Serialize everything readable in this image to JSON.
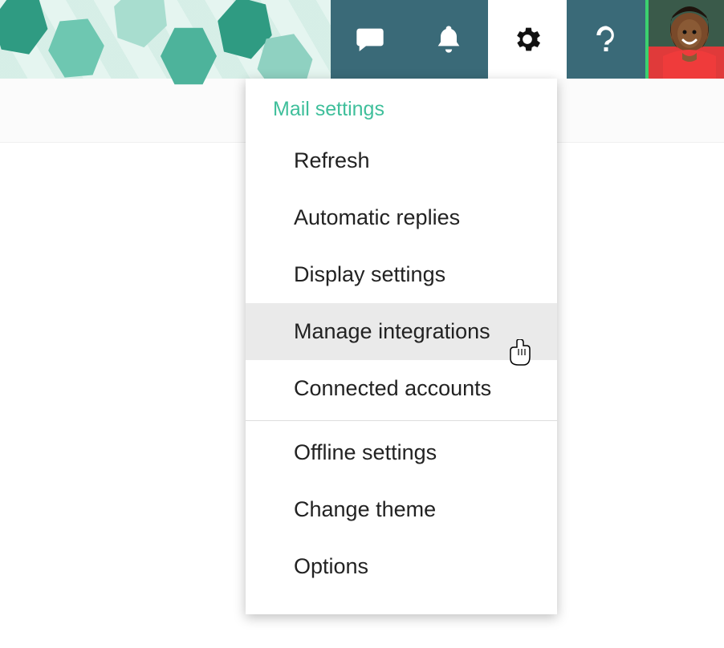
{
  "header": {
    "icons": {
      "chat": "chat-icon",
      "bell": "bell-icon",
      "gear": "gear-icon",
      "help": "help-icon"
    }
  },
  "menu": {
    "header": "Mail settings",
    "items": {
      "refresh": "Refresh",
      "automatic_replies": "Automatic replies",
      "display_settings": "Display settings",
      "manage_integrations": "Manage integrations",
      "connected_accounts": "Connected accounts",
      "offline_settings": "Offline settings",
      "change_theme": "Change theme",
      "options": "Options"
    }
  }
}
